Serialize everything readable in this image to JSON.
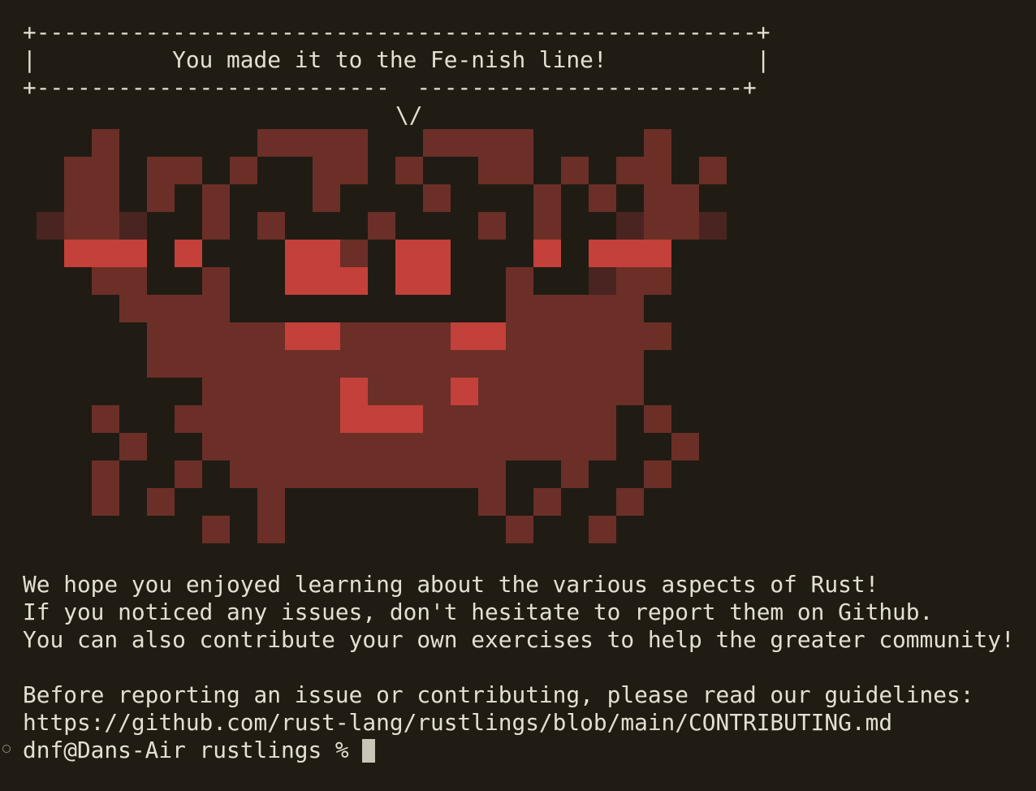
{
  "theme": {
    "background": "#201c14",
    "foreground": "#e3e0d2",
    "crab_body": "#6b2f27",
    "crab_dark": "#4a2420",
    "crab_light": "#c4403a"
  },
  "banner": {
    "top_border": "+-----------------------------------------------------+",
    "message_line": "|          You made it to the Fe-nish line!           |",
    "bottom_border": "+--------------------------  ------------------------+",
    "speech_tail": "\\/"
  },
  "mascot": {
    "icon": "ferris-crab-pixel-art"
  },
  "messages": [
    "We hope you enjoyed learning about the various aspects of Rust!",
    "If you noticed any issues, don't hesitate to report them on Github.",
    "You can also contribute your own exercises to help the greater community!",
    "",
    "Before reporting an issue or contributing, please read our guidelines:",
    "https://github.com/rust-lang/rustlings/blob/main/CONTRIBUTING.md"
  ],
  "prompt": {
    "text": "dnf@Dans-Air rustlings % "
  }
}
